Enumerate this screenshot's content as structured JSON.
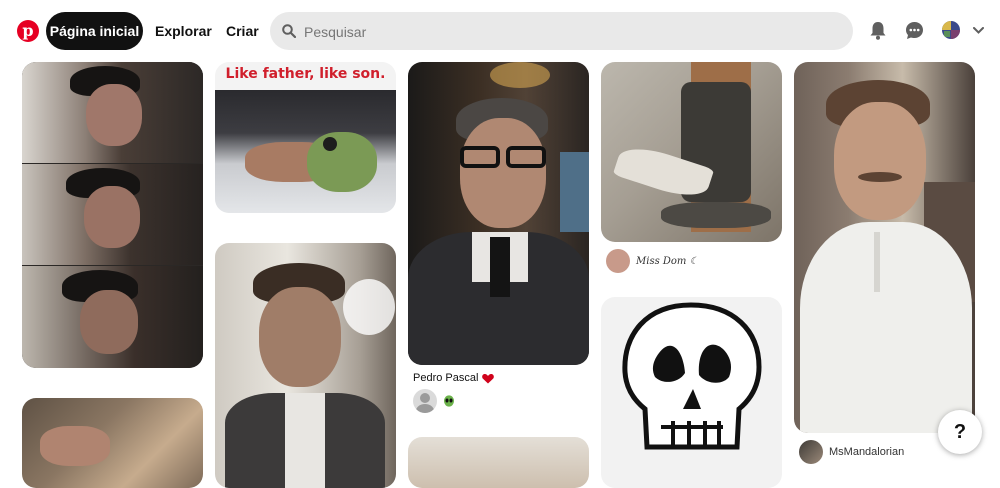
{
  "header": {
    "logo_icon": "pinterest-logo",
    "nav": {
      "home": "Página inicial",
      "explore": "Explorar",
      "create": "Criar"
    },
    "search": {
      "placeholder": "Pesquisar",
      "value": ""
    },
    "icons": [
      "bell-icon",
      "chat-icon",
      "avatar",
      "chevron-down-icon"
    ]
  },
  "pins": [
    {
      "id": "pin-1",
      "caption": ""
    },
    {
      "id": "pin-2",
      "title_text": "Like father, like son."
    },
    {
      "id": "pin-3",
      "caption": ""
    },
    {
      "id": "pin-4",
      "caption": "Pedro Pascal",
      "caption_icon": "heart-icon",
      "creator_icon": "alien-emoji"
    },
    {
      "id": "pin-6",
      "creator": "Miss Dom ☾"
    },
    {
      "id": "pin-8",
      "creator": "MsMandalorian"
    }
  ],
  "help_button": {
    "label": "?"
  },
  "colors": {
    "brand": "#e60023",
    "active_nav": "#111111",
    "search_bg": "#e9e9e9"
  }
}
